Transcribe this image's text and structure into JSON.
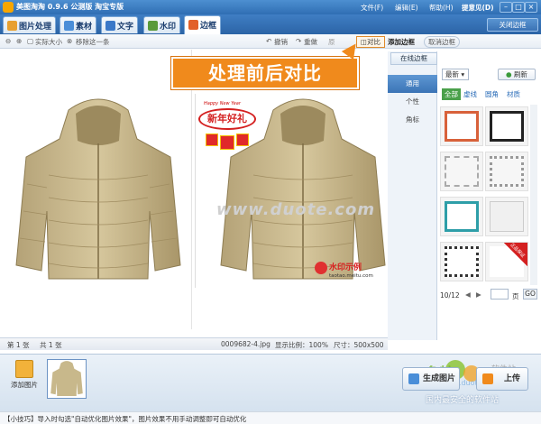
{
  "window": {
    "title": "美图淘淘 0.9.6 公测版 淘宝专版",
    "menu": [
      "文件(F)",
      "编辑(E)",
      "帮助(H)",
      "提意见(D)"
    ]
  },
  "tabs": [
    {
      "label": "图片处理",
      "color": "#e8a030"
    },
    {
      "label": "素材",
      "color": "#4a8ed8"
    },
    {
      "label": "文字",
      "color": "#3a78c8"
    },
    {
      "label": "水印",
      "color": "#5a9a3a"
    },
    {
      "label": "边框",
      "color": "#e2602a"
    }
  ],
  "close_frame": "关闭边框",
  "toolbar": {
    "actual_size": "实际大小",
    "remove_one": "移除这一条",
    "undo": "撤销",
    "redo": "重做",
    "reset": "原",
    "compare": "对比",
    "add_frame": "添加边框",
    "cancel_frame": "取消边框"
  },
  "callout": "处理前后对比",
  "image_overlays": {
    "happy_new_year": "Happy New Year",
    "nian": "新年好礼",
    "watermark_site": "www.duote.com",
    "watermark_small": "水印示例",
    "watermark_url": "taotao.meitu.com"
  },
  "status": {
    "page": "第 1 张",
    "total": "共 1 张",
    "filename": "0009682-4.jpg",
    "ratio_label": "显示比例：100%",
    "size_label": "尺寸：500x500"
  },
  "frame_panel": {
    "online_tab": "在线边框",
    "categories": [
      "通用",
      "个性",
      "角标"
    ],
    "sort": "最新",
    "refresh": "刷新",
    "filters": [
      "全部",
      "虚线",
      "圆角",
      "材质"
    ],
    "badge_text": "正品保证",
    "pager": {
      "current": "10/12",
      "page_label": "页",
      "go": "GO"
    }
  },
  "bottom": {
    "add_picture": "添加图片",
    "generate": "生成图片",
    "upload": "上传"
  },
  "site_watermark": {
    "brand": "多特",
    "sub": "软件站",
    "slogan": "国内最安全的软件站",
    "url": "www.duote.com"
  },
  "tip": "【小技巧】导入时勾选\"自动优化图片效果\"，图片效果不用手动调整即可自动优化",
  "colors": {
    "accent": "#f08a1c",
    "titlebar": "#2f6eb3",
    "active_tab": "#3b74b6"
  }
}
